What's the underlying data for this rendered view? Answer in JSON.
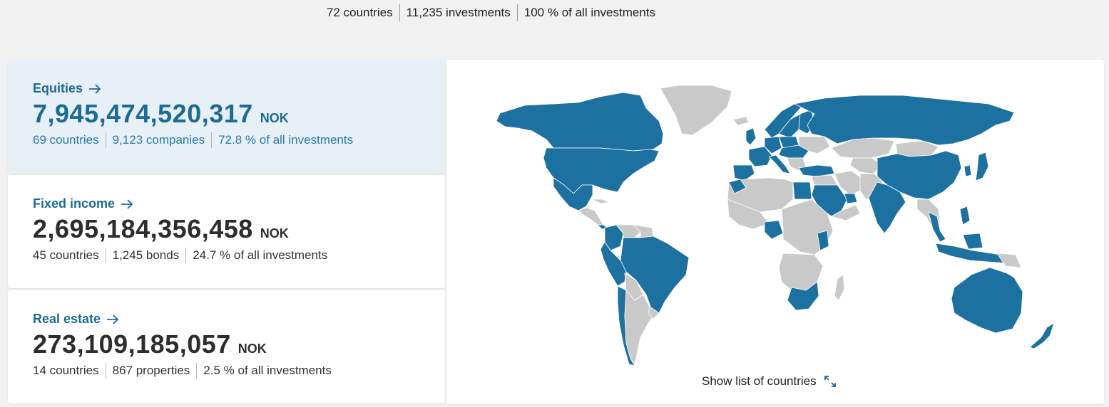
{
  "summary": {
    "countries": "72 countries",
    "investments": "11,235 investments",
    "share": "100 % of all investments"
  },
  "cards": [
    {
      "title": "Equities",
      "value": "7,945,474,520,317",
      "currency": "NOK",
      "meta": [
        "69 countries",
        "9,123 companies",
        "72.8 % of all investments"
      ]
    },
    {
      "title": "Fixed income",
      "value": "2,695,184,356,458",
      "currency": "NOK",
      "meta": [
        "45 countries",
        "1,245 bonds",
        "24.7 % of all investments"
      ]
    },
    {
      "title": "Real estate",
      "value": "273,109,185,057",
      "currency": "NOK",
      "meta": [
        "14 countries",
        "867 properties",
        "2.5 % of all investments"
      ]
    }
  ],
  "map": {
    "show_list_label": "Show list of countries",
    "colors": {
      "invested": "#1c71a0",
      "not_invested": "#c9c9c9",
      "border": "#ffffff",
      "accent": "#1d6b95"
    },
    "icons": {
      "title_arrow": "arrow-right-icon",
      "expand": "expand-icon"
    }
  }
}
